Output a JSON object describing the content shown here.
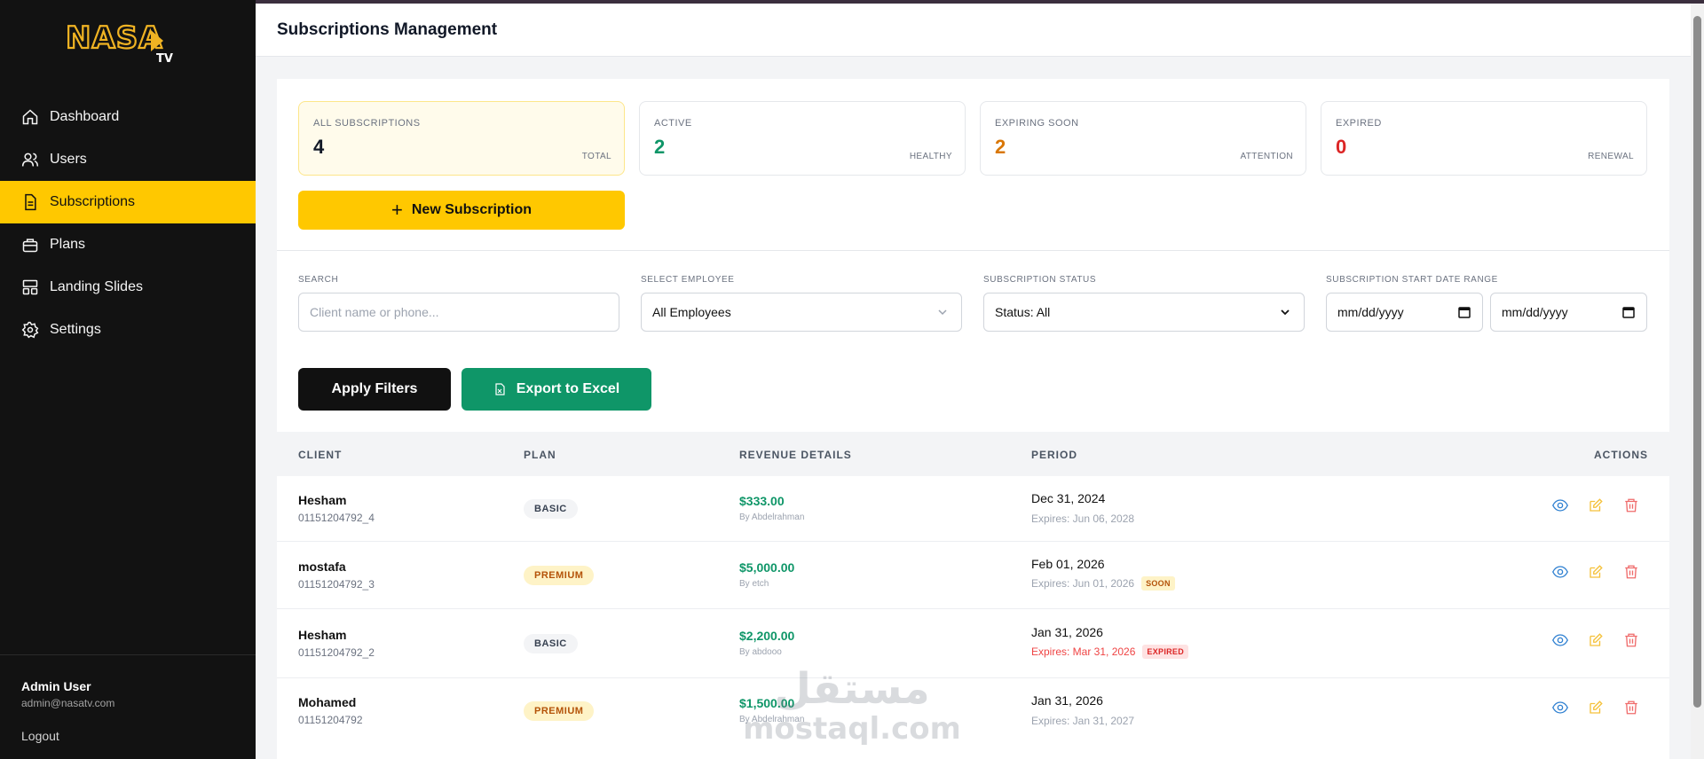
{
  "app": {
    "logo_text": "NASA",
    "logo_sub": "TV"
  },
  "sidebar": {
    "items": [
      {
        "label": "Dashboard",
        "icon": "home-icon",
        "active": false
      },
      {
        "label": "Users",
        "icon": "users-icon",
        "active": false
      },
      {
        "label": "Subscriptions",
        "icon": "document-icon",
        "active": true
      },
      {
        "label": "Plans",
        "icon": "briefcase-icon",
        "active": false
      },
      {
        "label": "Landing Slides",
        "icon": "slides-icon",
        "active": false
      },
      {
        "label": "Settings",
        "icon": "gear-icon",
        "active": false
      }
    ],
    "user_name": "Admin User",
    "user_email": "admin@nasatv.com",
    "logout_label": "Logout"
  },
  "header": {
    "title": "Subscriptions Management"
  },
  "stats": [
    {
      "label": "ALL SUBSCRIPTIONS",
      "value": "4",
      "note": "TOTAL",
      "color": "#111827"
    },
    {
      "label": "ACTIVE",
      "value": "2",
      "note": "HEALTHY",
      "color": "#0f9668"
    },
    {
      "label": "EXPIRING SOON",
      "value": "2",
      "note": "ATTENTION",
      "color": "#d97706"
    },
    {
      "label": "EXPIRED",
      "value": "0",
      "note": "RENEWAL",
      "color": "#dc2626"
    }
  ],
  "new_button_label": "New Subscription",
  "filters": {
    "search_label": "SEARCH",
    "search_placeholder": "Client name or phone...",
    "employee_label": "SELECT EMPLOYEE",
    "employee_value": "All Employees",
    "status_label": "SUBSCRIPTION STATUS",
    "status_value": "Status: All",
    "date_label": "SUBSCRIPTION START DATE RANGE",
    "date_from_placeholder": "mm/dd/yyyy",
    "date_to_placeholder": "mm/dd/yyyy",
    "apply_label": "Apply Filters",
    "export_label": "Export to Excel"
  },
  "table": {
    "headers": {
      "client": "CLIENT",
      "plan": "PLAN",
      "revenue": "REVENUE DETAILS",
      "period": "PERIOD",
      "actions": "ACTIONS"
    },
    "rows": [
      {
        "name": "Hesham",
        "phone": "01151204792_4",
        "plan": "BASIC",
        "amount": "$333.00",
        "by": "By Abdelrahman",
        "date": "Dec 31, 2024",
        "expires": "Expires: Jun 06, 2028",
        "tag": ""
      },
      {
        "name": "mostafa",
        "phone": "01151204792_3",
        "plan": "PREMIUM",
        "amount": "$5,000.00",
        "by": "By etch",
        "date": "Feb 01, 2026",
        "expires": "Expires: Jun 01, 2026",
        "tag": "SOON"
      },
      {
        "name": "Hesham",
        "phone": "01151204792_2",
        "plan": "BASIC",
        "amount": "$2,200.00",
        "by": "By abdooo",
        "date": "Jan 31, 2026",
        "expires": "Expires: Mar 31, 2026",
        "tag": "EXPIRED"
      },
      {
        "name": "Mohamed",
        "phone": "01151204792",
        "plan": "PREMIUM",
        "amount": "$1,500.00",
        "by": "By Abdelrahman",
        "date": "Jan 31, 2026",
        "expires": "Expires: Jan 31, 2027",
        "tag": ""
      }
    ]
  },
  "watermark": {
    "arabic": "مستقل",
    "latin": "mostaql.com"
  },
  "colors": {
    "accent": "#ffc800",
    "sidebar_bg": "#121212",
    "success": "#0f9668",
    "danger": "#ef4444",
    "view_icon": "#2f80d1",
    "edit_icon": "#f5c13a",
    "delete_icon": "#ef6b6b"
  }
}
